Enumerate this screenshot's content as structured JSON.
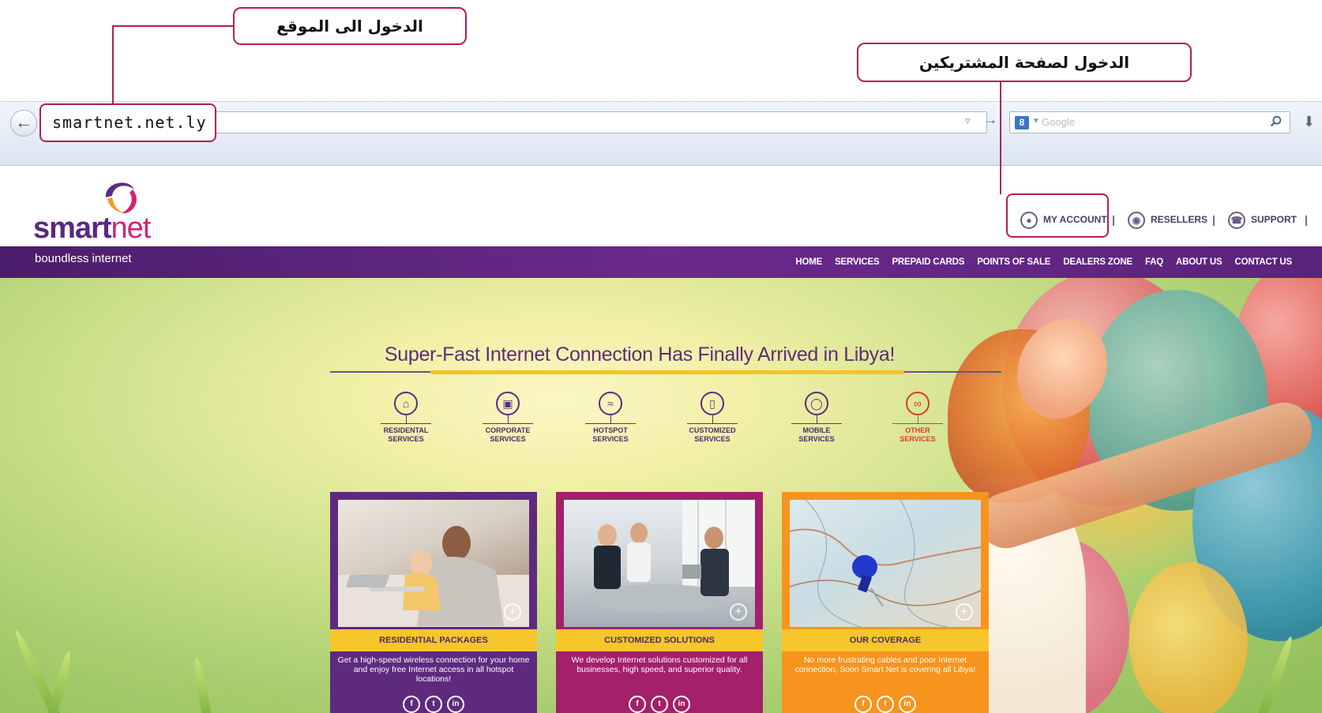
{
  "annotations": {
    "site_login": "الدخول الى الموقع",
    "subscriber_login": "الدخول لصفحة المشتريكين"
  },
  "browser": {
    "url": "smartnet.net.ly",
    "search_engine_label": "8",
    "search_placeholder": "Google",
    "icons": [
      "back-arrow-icon",
      "dropdown-icon",
      "go-arrow-icon",
      "search-icon",
      "download-icon"
    ]
  },
  "site": {
    "brand_word": "smart",
    "brand_word_accent": "net",
    "tagline": "boundless internet",
    "colors": {
      "primary": "#5c2d80",
      "accent": "#d2236f",
      "yellow": "#f6c62b",
      "orange": "#f7941d"
    },
    "topnav": [
      {
        "label": "MY ACCOUNT",
        "icon": "user-icon"
      },
      {
        "label": "RESELLERS",
        "icon": "group-icon"
      },
      {
        "label": "SUPPORT",
        "icon": "phone-icon"
      }
    ],
    "mainnav": [
      "HOME",
      "SERVICES",
      "PREPAID CARDS",
      "POINTS OF SALE",
      "DEALERS ZONE",
      "FAQ",
      "ABOUT US",
      "CONTACT US"
    ]
  },
  "hero": {
    "headline": "Super-Fast Internet Connection Has Finally Arrived in Libya!",
    "services": [
      {
        "line1": "RESIDENTAL",
        "line2": "SERVICES",
        "icon": "home-icon"
      },
      {
        "line1": "CORPORATE",
        "line2": "SERVICES",
        "icon": "briefcase-icon"
      },
      {
        "line1": "HOTSPOT",
        "line2": "SERVICES",
        "icon": "wifi-icon"
      },
      {
        "line1": "CUSTOMIZED",
        "line2": "SERVICES",
        "icon": "tablet-icon"
      },
      {
        "line1": "MOBILE",
        "line2": "SERVICES",
        "icon": "bulb-icon"
      },
      {
        "line1": "OTHER",
        "line2": "SERVICES",
        "icon": "link-icon"
      }
    ],
    "cards": [
      {
        "title": "RESIDENTIAL PACKAGES",
        "text": "Get a high-speed wireless connection for your home and enjoy free Internet access in all hotspot locations!",
        "color": "#5e2a7e"
      },
      {
        "title": "CUSTOMIZED SOLUTIONS",
        "text": "We develop Internet solutions customized for all businesses, high speed, and superior quality.",
        "color": "#a3206a"
      },
      {
        "title": "OUR COVERAGE",
        "text": "No more frustrating cables and poor Internet connection, Soon Smart Net is covering all Libya!",
        "color": "#f7941d"
      }
    ],
    "social": [
      "f",
      "t",
      "in"
    ]
  }
}
